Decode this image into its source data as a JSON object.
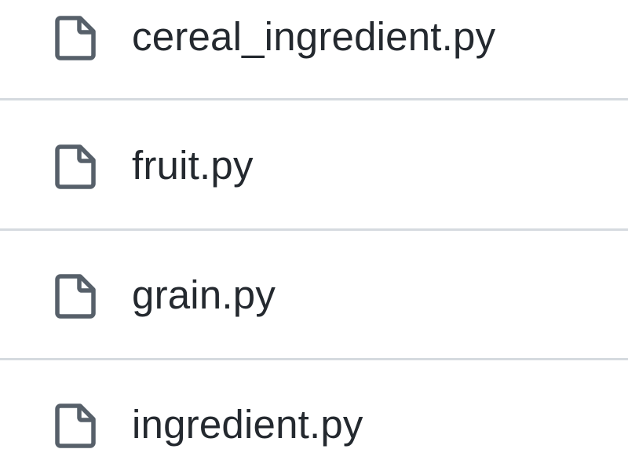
{
  "file_list": {
    "icon": "file-icon",
    "items": [
      {
        "name": "cereal_ingredient.py"
      },
      {
        "name": "fruit.py"
      },
      {
        "name": "grain.py"
      },
      {
        "name": "ingredient.py"
      }
    ]
  },
  "colors": {
    "text": "#24292f",
    "icon": "#57606a",
    "divider": "#d5dadf",
    "background": "#ffffff"
  }
}
